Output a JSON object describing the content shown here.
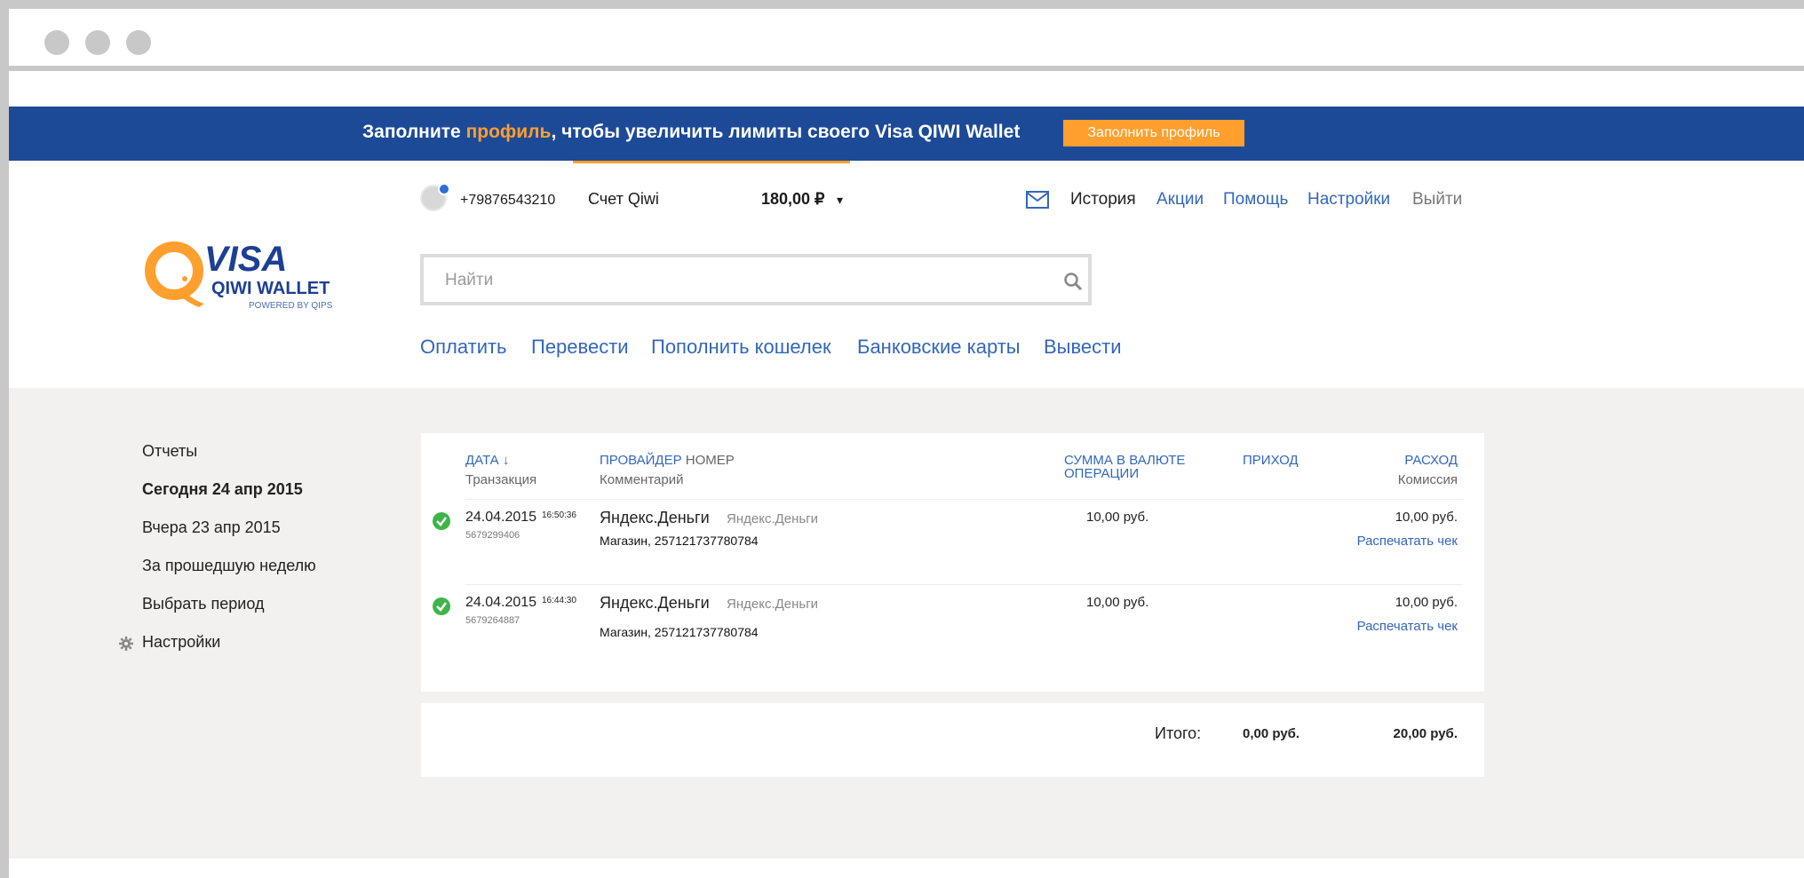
{
  "banner": {
    "text_before": "Заполните ",
    "text_highlight": "профиль",
    "text_after": ", чтобы увеличить лимиты своего Visa QIWI Wallet",
    "button_label": "Заполнить профиль"
  },
  "logo": {
    "visa": "VISA",
    "qiwi": "QIWI WALLET",
    "powered": "POWERED BY QIPS"
  },
  "account": {
    "phone": "+79876543210",
    "label": "Счет Qiwi",
    "balance": "180,00 ₽",
    "caret": "▾"
  },
  "topnav": {
    "history": "История",
    "promo": "Акции",
    "help": "Помощь",
    "settings": "Настройки",
    "logout": "Выйти"
  },
  "search": {
    "placeholder": "Найти"
  },
  "mainnav": [
    "Оплатить",
    "Перевести",
    "Пополнить кошелек",
    "Банковские карты",
    "Вывести"
  ],
  "sidebar": {
    "items": [
      "Отчеты",
      "Сегодня 24 апр 2015",
      "Вчера 23 апр 2015",
      "За прошедшую неделю",
      "Выбрать период"
    ],
    "settings": "Настройки"
  },
  "table": {
    "headers": {
      "date": "ДАТА ↓",
      "date_sub": "Транзакция",
      "provider": "ПРОВАЙДЕР",
      "number": " НОМЕР",
      "provider_sub": "Комментарий",
      "sum_line1": "СУММА В ВАЛЮТЕ",
      "sum_line2": "ОПЕРАЦИИ",
      "income": "ПРИХОД",
      "expense": "РАСХОД",
      "expense_sub": "Комиссия"
    },
    "rows": [
      {
        "date": "24.04.2015",
        "time": "16:50:36",
        "id": "5679299406",
        "provider": "Яндекс.Деньги",
        "provider_sub": "Яндекс.Деньги",
        "comment": "Магазин, 257121737780784",
        "amount": "10,00 руб.",
        "expense": "10,00 руб.",
        "print": "Распечатать чек"
      },
      {
        "date": "24.04.2015",
        "time": "16:44:30",
        "id": "5679264887",
        "provider": "Яндекс.Деньги",
        "provider_sub": "Яндекс.Деньги",
        "comment": "Магазин, 257121737780784",
        "amount": "10,00 руб.",
        "expense": "10,00 руб.",
        "print": "Распечатать чек"
      }
    ],
    "total": {
      "label": "Итого:",
      "income": "0,00 руб.",
      "expense": "20,00 руб."
    }
  },
  "colors": {
    "banner": "#1d4a96",
    "accent": "#ff9f2e",
    "link": "#3366bb",
    "content_bg": "#f2f1ef",
    "success": "#3db548"
  }
}
